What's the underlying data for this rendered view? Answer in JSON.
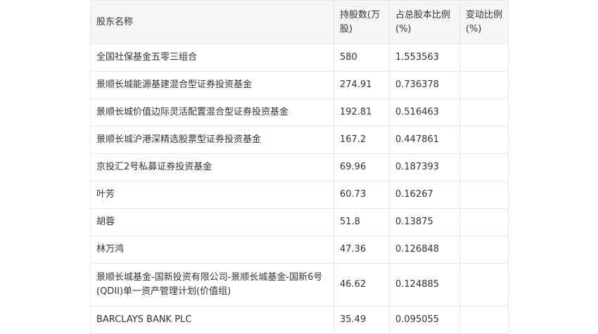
{
  "table": {
    "headers": {
      "name": "股东名称",
      "shares": "持股数(万股)",
      "ratio": "占总股本比例(%)",
      "change": "变动比例(%)"
    },
    "rows": [
      {
        "name": "全国社保基金五零三组合",
        "shares": "580",
        "ratio": "1.553563",
        "change": ""
      },
      {
        "name": "景顺长城能源基建混合型证券投资基金",
        "shares": "274.91",
        "ratio": "0.736378",
        "change": ""
      },
      {
        "name": "景顺长城价值边际灵活配置混合型证券投资基金",
        "shares": "192.81",
        "ratio": "0.516463",
        "change": ""
      },
      {
        "name": "景顺长城沪港深精选股票型证券投资基金",
        "shares": "167.2",
        "ratio": "0.447861",
        "change": ""
      },
      {
        "name": "京投汇2号私募证券投资基金",
        "shares": "69.96",
        "ratio": "0.187393",
        "change": ""
      },
      {
        "name": "叶芳",
        "shares": "60.73",
        "ratio": "0.16267",
        "change": ""
      },
      {
        "name": "胡蓉",
        "shares": "51.8",
        "ratio": "0.13875",
        "change": ""
      },
      {
        "name": "林万鸿",
        "shares": "47.36",
        "ratio": "0.126848",
        "change": ""
      },
      {
        "name": "景顺长城基金-国新投资有限公司-景顺长城基金-国新6号(QDII)单一资产管理计划(价值组)",
        "shares": "46.62",
        "ratio": "0.124885",
        "change": ""
      },
      {
        "name": "BARCLAYS BANK PLC",
        "shares": "35.49",
        "ratio": "0.095055",
        "change": ""
      }
    ]
  }
}
